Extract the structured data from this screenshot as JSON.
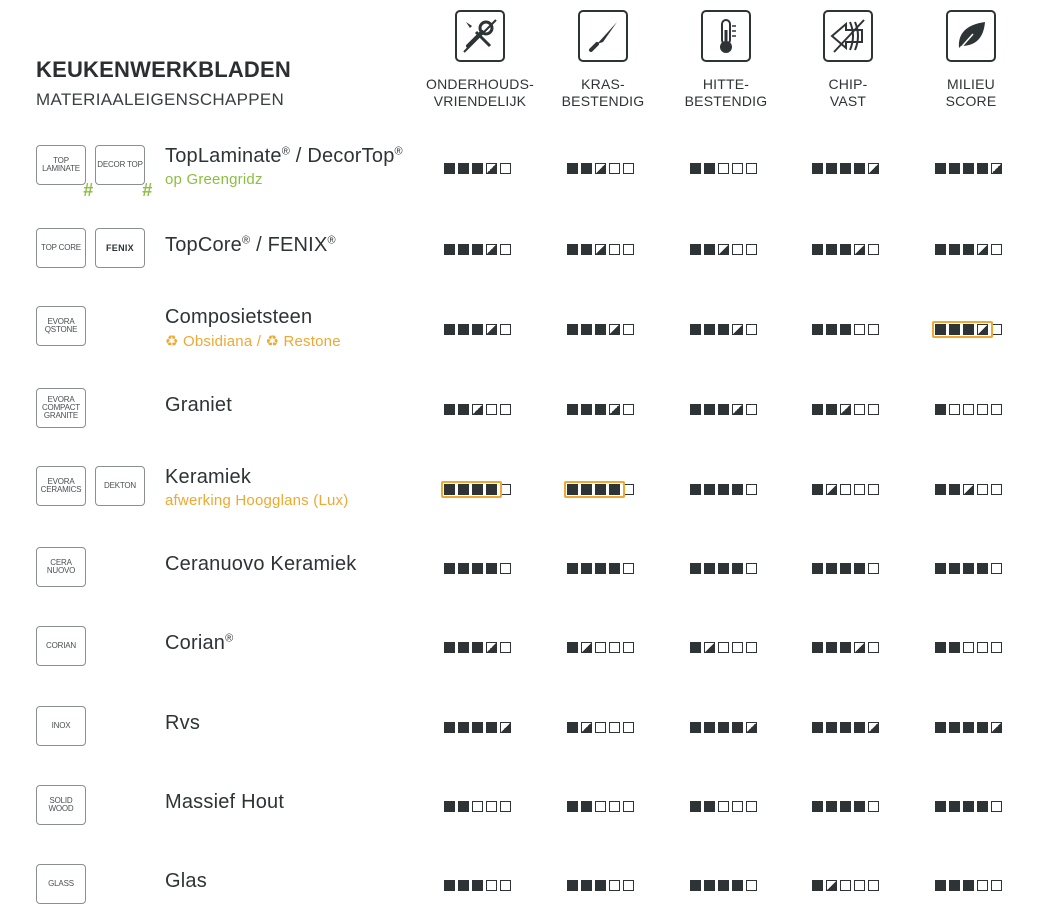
{
  "header": {
    "title": "KEUKENWERKBLADEN",
    "subtitle": "MATERIAALEIGENSCHAPPEN"
  },
  "columns": [
    {
      "icon": "wrench-screwdriver-icon",
      "line1": "ONDERHOUDS-",
      "line2": "VRIENDELIJK"
    },
    {
      "icon": "knife-icon",
      "line1": "KRAS-",
      "line2": "BESTENDIG"
    },
    {
      "icon": "thermometer-icon",
      "line1": "HITTE-",
      "line2": "BESTENDIG"
    },
    {
      "icon": "shield-impact-icon",
      "line1": "CHIP-",
      "line2": "VAST"
    },
    {
      "icon": "leaf-icon",
      "line1": "MILIEU",
      "line2": "SCORE"
    }
  ],
  "colors": {
    "accent_green": "#8cbf3f",
    "accent_orange": "#f0a830",
    "dark": "#2e3436"
  },
  "rows": [
    {
      "logos": [
        {
          "text": "TOP LAMINATE",
          "hash": "#"
        },
        {
          "text": "DECOR TOP",
          "hash": "#"
        }
      ],
      "name": "TopLaminate",
      "name_mark": "®",
      "name2": " / DecorTop",
      "name2_mark": "®",
      "sub": "op Greengridz",
      "sub_color": "green",
      "ratings": [
        3.5,
        2.5,
        2,
        4.5,
        4.5
      ],
      "highlight": []
    },
    {
      "logos": [
        {
          "text": "TOP CORE"
        },
        {
          "text": "FENIX",
          "bold": true
        }
      ],
      "name": "TopCore",
      "name_mark": "®",
      "name2": " / FENIX",
      "name2_mark": "®",
      "sub": "",
      "sub_color": "",
      "ratings": [
        3.5,
        2.5,
        2.5,
        3.5,
        3.5
      ],
      "highlight": []
    },
    {
      "logos": [
        {
          "text": "EVORA QSTONE"
        }
      ],
      "name": "Composietsteen",
      "name_mark": "",
      "name2": "",
      "name2_mark": "",
      "sub": "♻ Obsidiana / ♻ Restone",
      "sub_color": "orange",
      "ratings": [
        3.5,
        3.5,
        3.5,
        3,
        3.5
      ],
      "highlight": [
        4
      ]
    },
    {
      "logos": [
        {
          "text": "EVORA COMPACT GRANITE"
        }
      ],
      "name": "Graniet",
      "name_mark": "",
      "name2": "",
      "name2_mark": "",
      "sub": "",
      "sub_color": "",
      "ratings": [
        2.5,
        3.5,
        3.5,
        2.5,
        1
      ],
      "highlight": []
    },
    {
      "logos": [
        {
          "text": "EVORA CERAMICS"
        },
        {
          "text": "DEKTON"
        }
      ],
      "name": "Keramiek",
      "name_mark": "",
      "name2": "",
      "name2_mark": "",
      "sub": "afwerking Hoogglans (Lux)",
      "sub_color": "orange",
      "ratings": [
        4,
        4,
        4,
        1.5,
        2.5
      ],
      "highlight": [
        0,
        1
      ]
    },
    {
      "logos": [
        {
          "text": "CERA NUOVO"
        }
      ],
      "name": "Ceranuovo Keramiek",
      "name_mark": "",
      "name2": "",
      "name2_mark": "",
      "sub": "",
      "sub_color": "",
      "ratings": [
        4,
        4,
        4,
        4,
        4
      ],
      "highlight": []
    },
    {
      "logos": [
        {
          "text": "CORIAN"
        }
      ],
      "name": "Corian",
      "name_mark": "®",
      "name2": "",
      "name2_mark": "",
      "sub": "",
      "sub_color": "",
      "ratings": [
        3.5,
        1.5,
        1.5,
        3.5,
        2
      ],
      "highlight": []
    },
    {
      "logos": [
        {
          "text": "INOX"
        }
      ],
      "name": "Rvs",
      "name_mark": "",
      "name2": "",
      "name2_mark": "",
      "sub": "",
      "sub_color": "",
      "ratings": [
        4.5,
        1.5,
        4.5,
        4.5,
        4.5
      ],
      "highlight": []
    },
    {
      "logos": [
        {
          "text": "SOLID WOOD"
        }
      ],
      "name": "Massief Hout",
      "name_mark": "",
      "name2": "",
      "name2_mark": "",
      "sub": "",
      "sub_color": "",
      "ratings": [
        2,
        2,
        2,
        4,
        4
      ],
      "highlight": []
    },
    {
      "logos": [
        {
          "text": "GLASS"
        }
      ],
      "name": "Glas",
      "name_mark": "",
      "name2": "",
      "name2_mark": "",
      "sub": "",
      "sub_color": "",
      "ratings": [
        3,
        3,
        4,
        1.5,
        3
      ],
      "highlight": []
    }
  ]
}
